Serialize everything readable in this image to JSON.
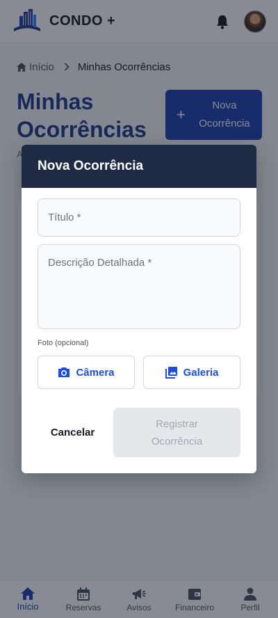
{
  "app": {
    "brand": "CONDO +",
    "logo_icon": "building-logo-icon",
    "notification_icon": "bell-icon",
    "avatar_icon": "user-avatar"
  },
  "breadcrumb": {
    "home_label": "Início",
    "current": "Minhas Ocorrências"
  },
  "page": {
    "title": "Minhas Ocorrências",
    "new_button_label": "Nova Ocorrência",
    "description_partial": "A n"
  },
  "modal": {
    "title": "Nova Ocorrência",
    "title_placeholder": "Título *",
    "description_placeholder": "Descrição Detalhada *",
    "photo_label": "Foto (opcional)",
    "camera_label": "Câmera",
    "gallery_label": "Galeria",
    "cancel_label": "Cancelar",
    "submit_label": "Registrar Ocorrência",
    "submit_enabled": false
  },
  "bottom_nav": {
    "items": [
      {
        "label": "Início",
        "icon": "home-icon",
        "active": true
      },
      {
        "label": "Reservas",
        "icon": "calendar-icon",
        "active": false
      },
      {
        "label": "Avisos",
        "icon": "megaphone-icon",
        "active": false
      },
      {
        "label": "Financeiro",
        "icon": "wallet-icon",
        "active": false
      },
      {
        "label": "Perfil",
        "icon": "person-icon",
        "active": false
      }
    ]
  },
  "colors": {
    "primary": "#1e40af",
    "title_blue": "#1e3a8a",
    "modal_header": "#1f2a44",
    "disabled_bg": "#e5e7eb"
  }
}
